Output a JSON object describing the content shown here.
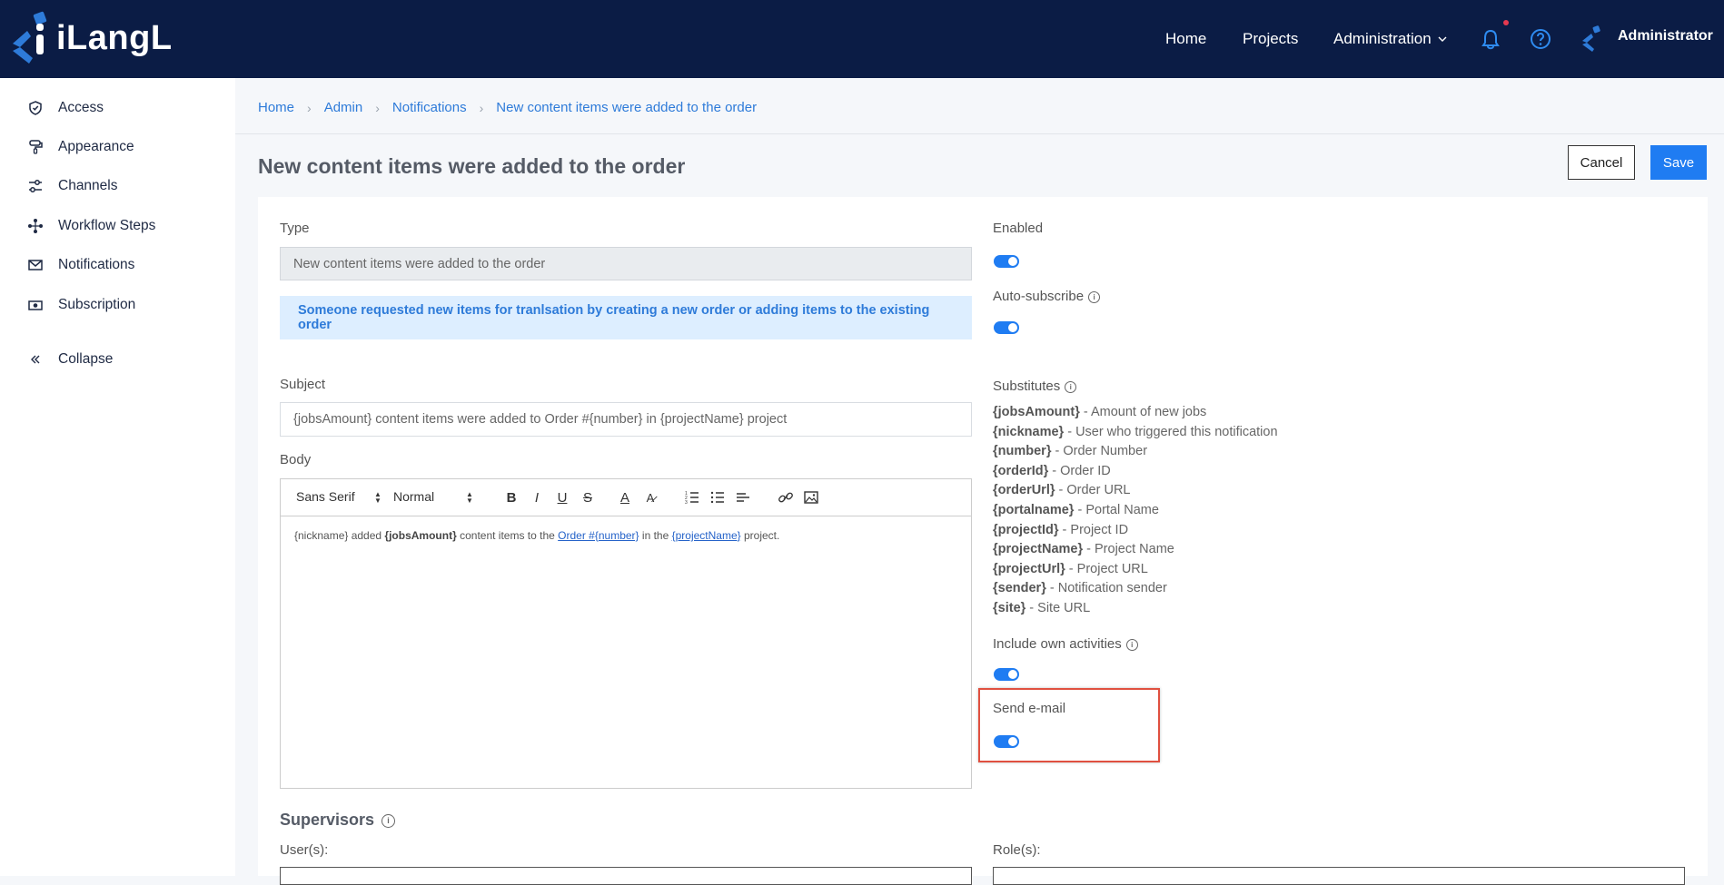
{
  "app": {
    "logo_text": "iLangL",
    "nav": {
      "home": "Home",
      "projects": "Projects",
      "administration": "Administration",
      "user": "Administrator"
    }
  },
  "sidebar": {
    "items": [
      {
        "label": "Access",
        "icon": "shield-icon"
      },
      {
        "label": "Appearance",
        "icon": "paint-roller-icon"
      },
      {
        "label": "Channels",
        "icon": "sliders-icon"
      },
      {
        "label": "Workflow Steps",
        "icon": "workflow-icon"
      },
      {
        "label": "Notifications",
        "icon": "envelope-icon"
      },
      {
        "label": "Subscription",
        "icon": "money-icon"
      }
    ],
    "collapse": "Collapse"
  },
  "breadcrumb": [
    "Home",
    "Admin",
    "Notifications",
    "New content items were added to the order"
  ],
  "page": {
    "title": "New content items were added to the order",
    "cancel": "Cancel",
    "save": "Save"
  },
  "form": {
    "type_label": "Type",
    "type_value": "New content items were added to the order",
    "alert": "Someone requested new items for tranlsation by creating a new order or adding items to the existing order",
    "subject_label": "Subject",
    "subject_value": "{jobsAmount} content items were added to Order #{number} in {projectName} project",
    "body_label": "Body",
    "toolbar": {
      "font": "Sans Serif",
      "size": "Normal"
    },
    "body": {
      "t1": "{nickname} added ",
      "b1": "{jobsAmount}",
      "t2": " content items to the ",
      "link1": "Order #{number}",
      "t3": " in the ",
      "link2": "{projectName}",
      "t4": " project."
    },
    "enabled_label": "Enabled",
    "enabled": true,
    "autosub_label": "Auto-subscribe",
    "autosub": true,
    "substitutes_label": "Substitutes",
    "substitutes": [
      {
        "key": "{jobsAmount}",
        "desc": " - Amount of new jobs"
      },
      {
        "key": "{nickname}",
        "desc": " - User who triggered this notification"
      },
      {
        "key": "{number}",
        "desc": " - Order Number"
      },
      {
        "key": "{orderId}",
        "desc": " - Order ID"
      },
      {
        "key": "{orderUrl}",
        "desc": " - Order URL"
      },
      {
        "key": "{portalname}",
        "desc": " - Portal Name"
      },
      {
        "key": "{projectId}",
        "desc": " - Project ID"
      },
      {
        "key": "{projectName}",
        "desc": " - Project Name"
      },
      {
        "key": "{projectUrl}",
        "desc": " - Project URL"
      },
      {
        "key": "{sender}",
        "desc": " - Notification sender"
      },
      {
        "key": "{site}",
        "desc": " - Site URL"
      }
    ],
    "own_label": "Include own activities",
    "own": true,
    "email_label": "Send e-mail",
    "email": true,
    "supervisors_label": "Supervisors",
    "users_label": "User(s):",
    "roles_label": "Role(s):"
  },
  "colors": {
    "topbar": "#0b1c45",
    "accent": "#1f7cf2",
    "highlight": "#e05040"
  }
}
